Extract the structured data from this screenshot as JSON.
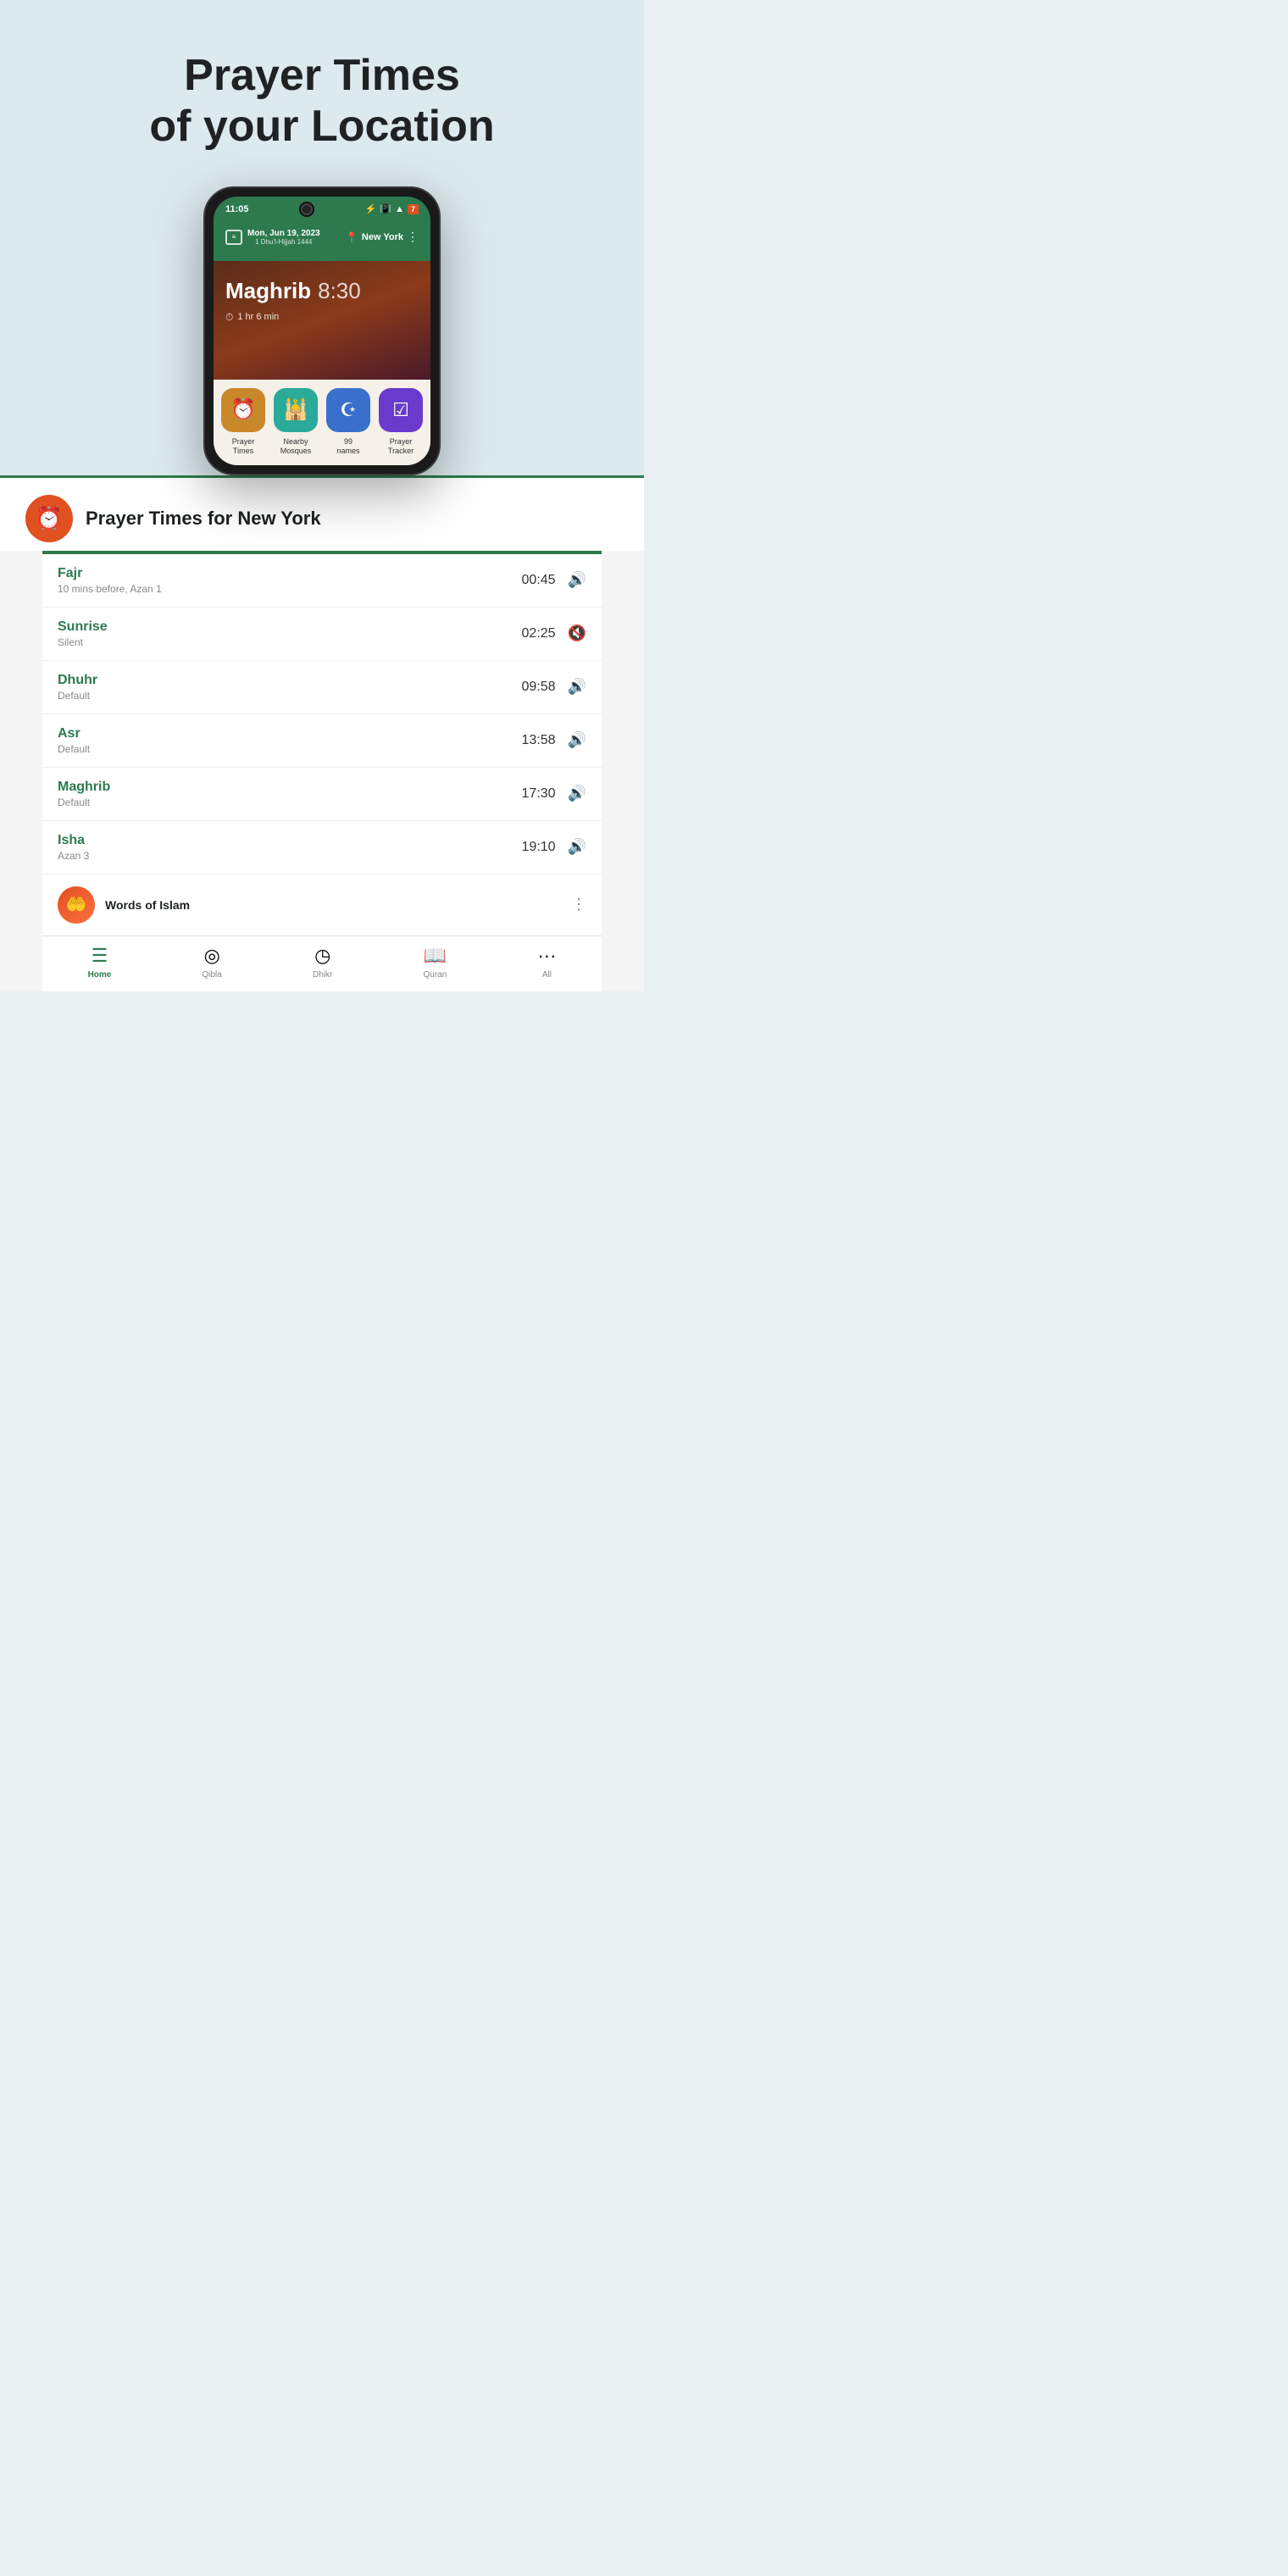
{
  "hero": {
    "title_line1": "Prayer Times",
    "title_line2": "of your Location"
  },
  "phone": {
    "status_bar": {
      "time": "11:05",
      "icons": "bluetooth vibrate wifi battery"
    },
    "app_header": {
      "date": "Mon, Jun 19, 2023",
      "hijri": "1 Dhu'l-Hijjah 1444",
      "location": "New York"
    },
    "prayer_display": {
      "prayer_name": "Maghrib",
      "prayer_time": "8:30",
      "time_remaining": "1 hr 6 min"
    },
    "features": [
      {
        "label": "Prayer\nTimes",
        "bg": "gold",
        "icon": "⏰"
      },
      {
        "label": "Nearby\nMosques",
        "bg": "teal",
        "icon": "🕌"
      },
      {
        "label": "99\nnames",
        "bg": "blue",
        "icon": "☪"
      },
      {
        "label": "Prayer\nTracker",
        "bg": "purple",
        "icon": "☑"
      }
    ]
  },
  "section_title": "Prayer Times for New York",
  "prayers": [
    {
      "name": "Fajr",
      "sub": "10 mins before, Azan 1",
      "time": "00:45",
      "sound": "on"
    },
    {
      "name": "Sunrise",
      "sub": "Silent",
      "time": "02:25",
      "sound": "off"
    },
    {
      "name": "Dhuhr",
      "sub": "Default",
      "time": "09:58",
      "sound": "on"
    },
    {
      "name": "Asr",
      "sub": "Default",
      "time": "13:58",
      "sound": "on"
    },
    {
      "name": "Maghrib",
      "sub": "Default",
      "time": "17:30",
      "sound": "on"
    },
    {
      "name": "Isha",
      "sub": "Azan 3",
      "time": "19:10",
      "sound": "on"
    }
  ],
  "words_of_islam": {
    "title": "Words of Islam"
  },
  "bottom_nav": [
    {
      "label": "Home",
      "active": true,
      "icon": "☰"
    },
    {
      "label": "Qibla",
      "active": false,
      "icon": "◎"
    },
    {
      "label": "Dhikr",
      "active": false,
      "icon": "◷"
    },
    {
      "label": "Quran",
      "active": false,
      "icon": "📖"
    },
    {
      "label": "All",
      "active": false,
      "icon": "···"
    }
  ]
}
